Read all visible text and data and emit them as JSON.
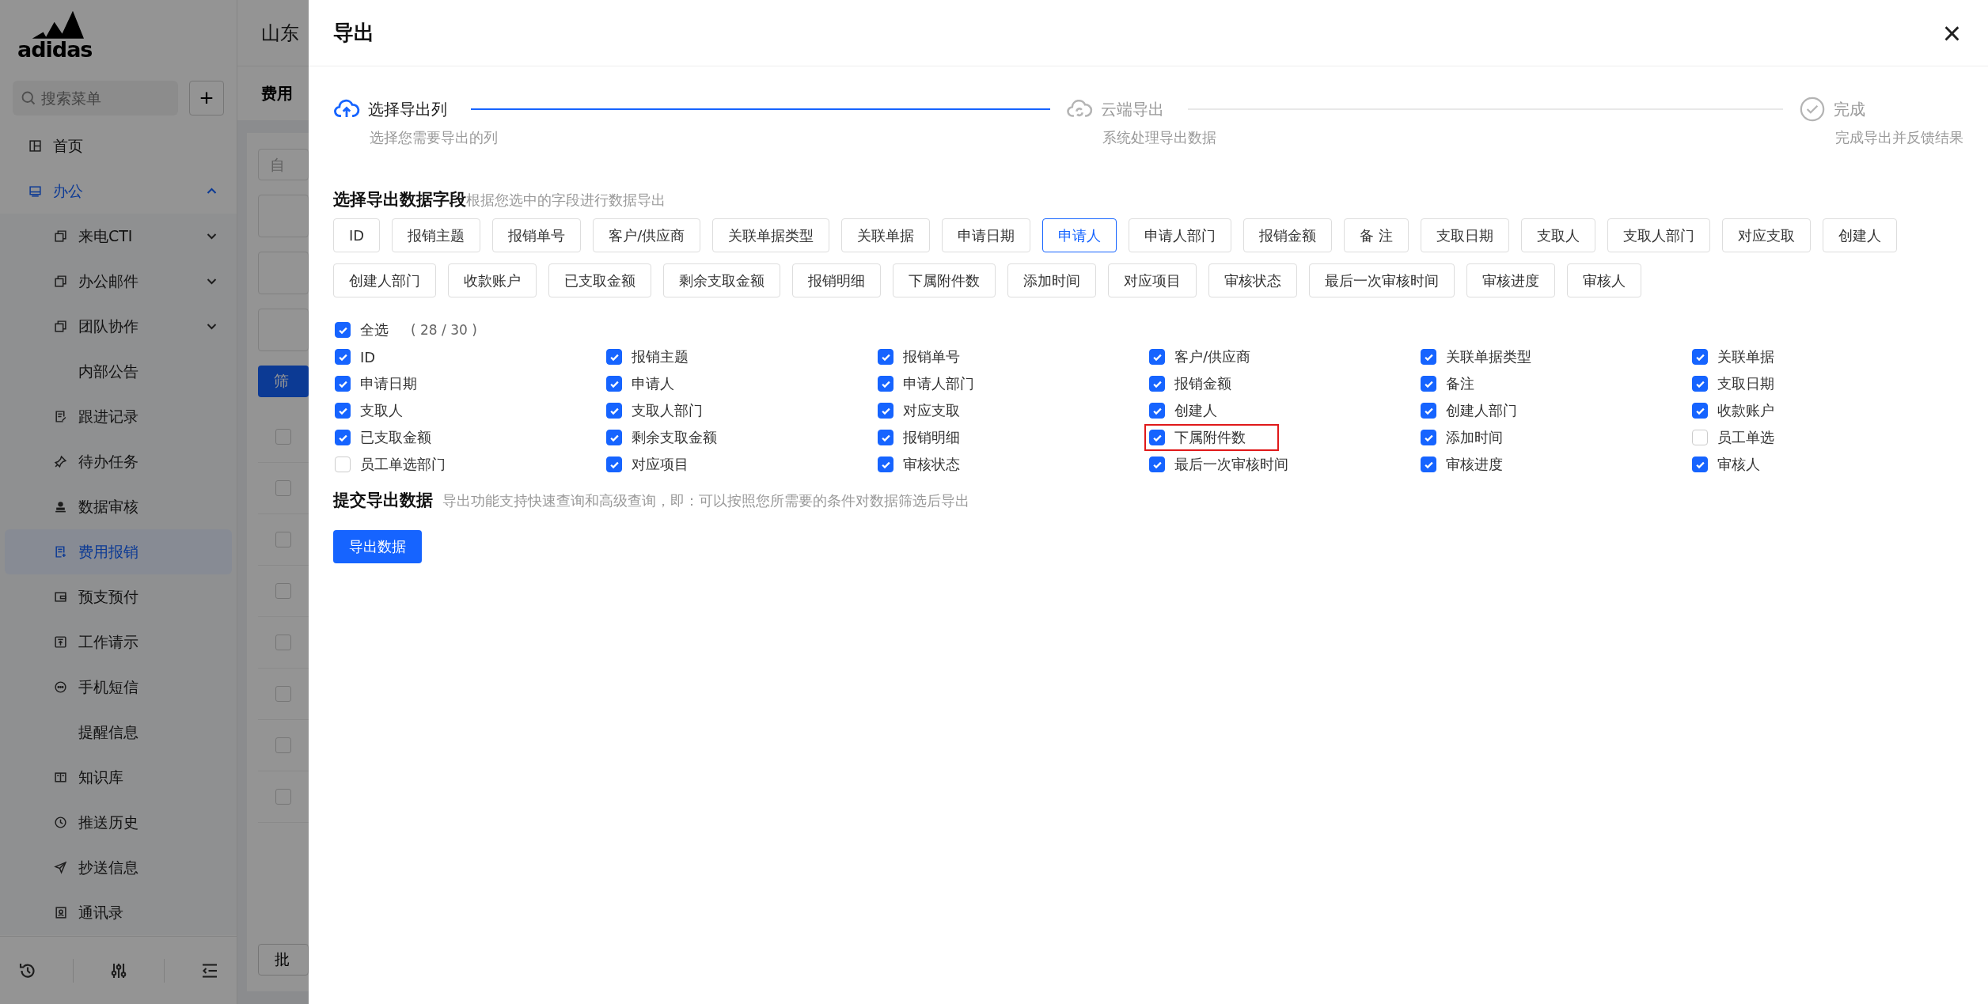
{
  "sidebar": {
    "logo": "adidas",
    "search": {
      "placeholder": "搜索菜单"
    },
    "add_button": "+",
    "items": [
      {
        "label": "首页",
        "selected": false
      },
      {
        "label": "办公",
        "expanded": true,
        "selected": false,
        "children": [
          {
            "label": "来电CTI",
            "expanded": false,
            "selected": false
          },
          {
            "label": "办公邮件",
            "expanded": false,
            "selected": false
          },
          {
            "label": "团队协作",
            "expanded": false,
            "selected": false
          },
          {
            "label": "内部公告",
            "selected": false
          },
          {
            "label": "跟进记录",
            "selected": false
          },
          {
            "label": "待办任务",
            "selected": false
          },
          {
            "label": "数据审核",
            "selected": false
          },
          {
            "label": "费用报销",
            "selected": true
          },
          {
            "label": "预支预付",
            "selected": false
          },
          {
            "label": "工作请示",
            "selected": false
          },
          {
            "label": "手机短信",
            "selected": false
          },
          {
            "label": "提醒信息",
            "selected": false
          },
          {
            "label": "知识库",
            "selected": false
          },
          {
            "label": "推送历史",
            "selected": false
          },
          {
            "label": "抄送信息",
            "selected": false
          },
          {
            "label": "通讯录",
            "selected": false
          }
        ]
      }
    ]
  },
  "background": {
    "header_title": "山东",
    "page_tab": "费用",
    "filter_field": "自",
    "filter_button": "筛",
    "batch_button": "批",
    "table_rows": [
      {
        "checked": false
      },
      {
        "checked": false
      },
      {
        "checked": false
      },
      {
        "checked": false
      },
      {
        "checked": false
      },
      {
        "checked": false
      },
      {
        "checked": false
      },
      {
        "checked": false
      }
    ]
  },
  "drawer": {
    "title": "导出",
    "close": "×",
    "steps": [
      {
        "title": "选择导出列",
        "description": "选择您需要导出的列",
        "active": true
      },
      {
        "title": "云端导出",
        "description": "系统处理导出数据",
        "active": false
      },
      {
        "title": "完成",
        "description": "完成导出并反馈结果",
        "active": false
      }
    ],
    "fields_section": {
      "title": "选择导出数据字段",
      "hint": "根据您选中的字段进行数据导出"
    },
    "tags": [
      {
        "label": "ID",
        "selected": false
      },
      {
        "label": "报销主题",
        "selected": false
      },
      {
        "label": "报销单号",
        "selected": false
      },
      {
        "label": "客户/供应商",
        "selected": false
      },
      {
        "label": "关联单据类型",
        "selected": false
      },
      {
        "label": "关联单据",
        "selected": false
      },
      {
        "label": "申请日期",
        "selected": false
      },
      {
        "label": "申请人",
        "selected": true
      },
      {
        "label": "申请人部门",
        "selected": false
      },
      {
        "label": "报销金额",
        "selected": false
      },
      {
        "label": "备 注",
        "selected": false
      },
      {
        "label": "支取日期",
        "selected": false
      },
      {
        "label": "支取人",
        "selected": false
      },
      {
        "label": "支取人部门",
        "selected": false
      },
      {
        "label": "对应支取",
        "selected": false
      },
      {
        "label": "创建人",
        "selected": false
      },
      {
        "label": "创建人部门",
        "selected": false
      },
      {
        "label": "收款账户",
        "selected": false
      },
      {
        "label": "已支取金额",
        "selected": false
      },
      {
        "label": "剩余支取金额",
        "selected": false
      },
      {
        "label": "报销明细",
        "selected": false
      },
      {
        "label": "下属附件数",
        "selected": false
      },
      {
        "label": "添加时间",
        "selected": false
      },
      {
        "label": "对应项目",
        "selected": false
      },
      {
        "label": "审核状态",
        "selected": false
      },
      {
        "label": "最后一次审核时间",
        "selected": false
      },
      {
        "label": "审核进度",
        "selected": false
      },
      {
        "label": "审核人",
        "selected": false
      }
    ],
    "select_all": {
      "label": "全选",
      "checked": true,
      "count": "( 28 / 30 )"
    },
    "columns": [
      {
        "label": "ID",
        "checked": true,
        "highlighted": false
      },
      {
        "label": "报销主题",
        "checked": true,
        "highlighted": false
      },
      {
        "label": "报销单号",
        "checked": true,
        "highlighted": false
      },
      {
        "label": "客户/供应商",
        "checked": true,
        "highlighted": false
      },
      {
        "label": "关联单据类型",
        "checked": true,
        "highlighted": false
      },
      {
        "label": "关联单据",
        "checked": true,
        "highlighted": false
      },
      {
        "label": "申请日期",
        "checked": true,
        "highlighted": false
      },
      {
        "label": "申请人",
        "checked": true,
        "highlighted": false
      },
      {
        "label": "申请人部门",
        "checked": true,
        "highlighted": false
      },
      {
        "label": "报销金额",
        "checked": true,
        "highlighted": false
      },
      {
        "label": "备注",
        "checked": true,
        "highlighted": false
      },
      {
        "label": "支取日期",
        "checked": true,
        "highlighted": false
      },
      {
        "label": "支取人",
        "checked": true,
        "highlighted": false
      },
      {
        "label": "支取人部门",
        "checked": true,
        "highlighted": false
      },
      {
        "label": "对应支取",
        "checked": true,
        "highlighted": false
      },
      {
        "label": "创建人",
        "checked": true,
        "highlighted": false
      },
      {
        "label": "创建人部门",
        "checked": true,
        "highlighted": false
      },
      {
        "label": "收款账户",
        "checked": true,
        "highlighted": false
      },
      {
        "label": "已支取金额",
        "checked": true,
        "highlighted": false
      },
      {
        "label": "剩余支取金额",
        "checked": true,
        "highlighted": false
      },
      {
        "label": "报销明细",
        "checked": true,
        "highlighted": false
      },
      {
        "label": "下属附件数",
        "checked": true,
        "highlighted": true
      },
      {
        "label": "添加时间",
        "checked": true,
        "highlighted": false
      },
      {
        "label": "员工单选",
        "checked": false,
        "highlighted": false
      },
      {
        "label": "员工单选部门",
        "checked": false,
        "highlighted": false
      },
      {
        "label": "对应项目",
        "checked": true,
        "highlighted": false
      },
      {
        "label": "审核状态",
        "checked": true,
        "highlighted": false
      },
      {
        "label": "最后一次审核时间",
        "checked": true,
        "highlighted": false
      },
      {
        "label": "审核进度",
        "checked": true,
        "highlighted": false
      },
      {
        "label": "审核人",
        "checked": true,
        "highlighted": false
      }
    ],
    "submit_section": {
      "title": "提交导出数据",
      "hint": "导出功能支持快速查询和高级查询，即：可以按照您所需要的条件对数据筛选后导出"
    },
    "export_button": "导出数据"
  }
}
